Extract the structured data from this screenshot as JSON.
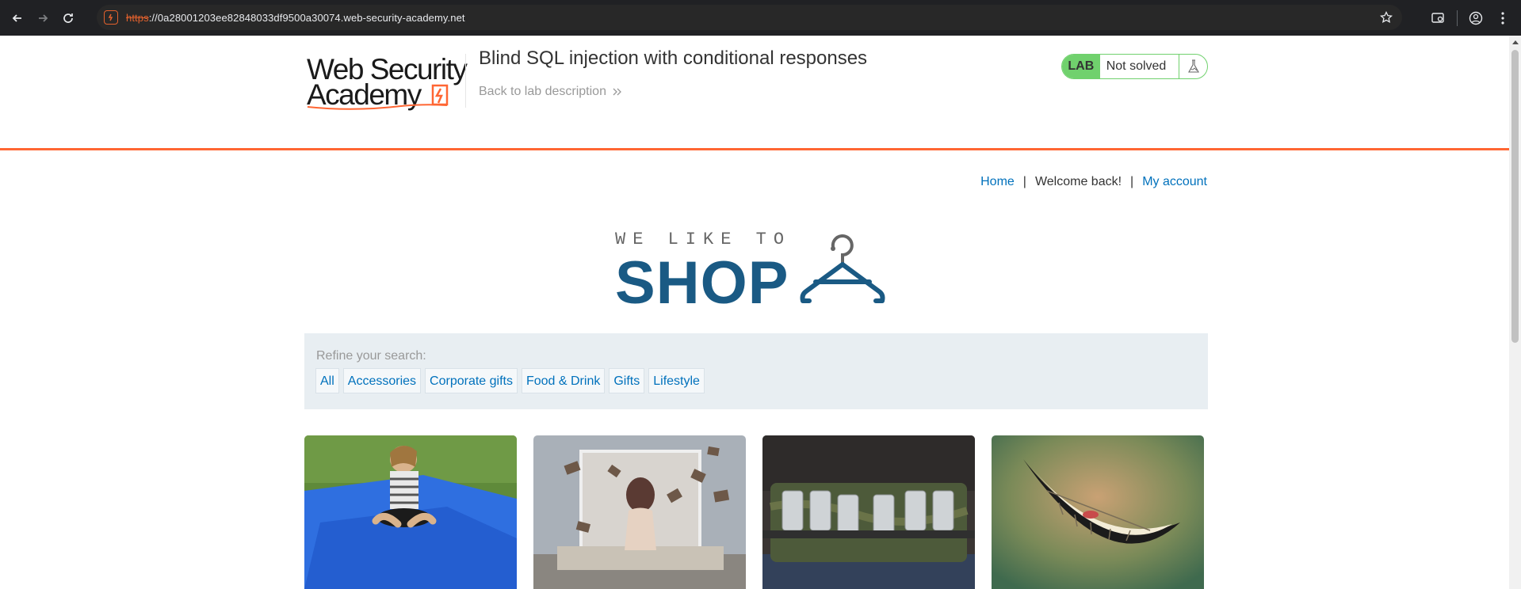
{
  "browser": {
    "url_scheme": "https",
    "url_rest": "://0a28001203ee82848033df9500a30074.web-security-academy.net"
  },
  "lab_header": {
    "logo_line1": "Web Security",
    "logo_line2": "Academy",
    "title": "Blind SQL injection with conditional responses",
    "back_link": "Back to lab description",
    "status_badge": "LAB",
    "status_text": "Not solved"
  },
  "nav": {
    "home": "Home",
    "welcome": "Welcome back!",
    "my_account": "My account"
  },
  "shop_logo": {
    "small_text": "WE LIKE TO",
    "big_text": "SHOP"
  },
  "filters": {
    "label": "Refine your search:",
    "categories": [
      "All",
      "Accessories",
      "Corporate gifts",
      "Food & Drink",
      "Gifts",
      "Lifestyle"
    ]
  },
  "products": [
    {
      "image": "child-on-blue-beanbag"
    },
    {
      "image": "woman-with-floating-books"
    },
    {
      "image": "beer-can-belt"
    },
    {
      "image": "cheshire-grin"
    }
  ],
  "colors": {
    "accent_orange": "#ff6633",
    "lab_green": "#70d16d",
    "link_blue": "#0071bc",
    "shop_blue": "#1a5a84",
    "filter_bg": "#e8eef2"
  }
}
